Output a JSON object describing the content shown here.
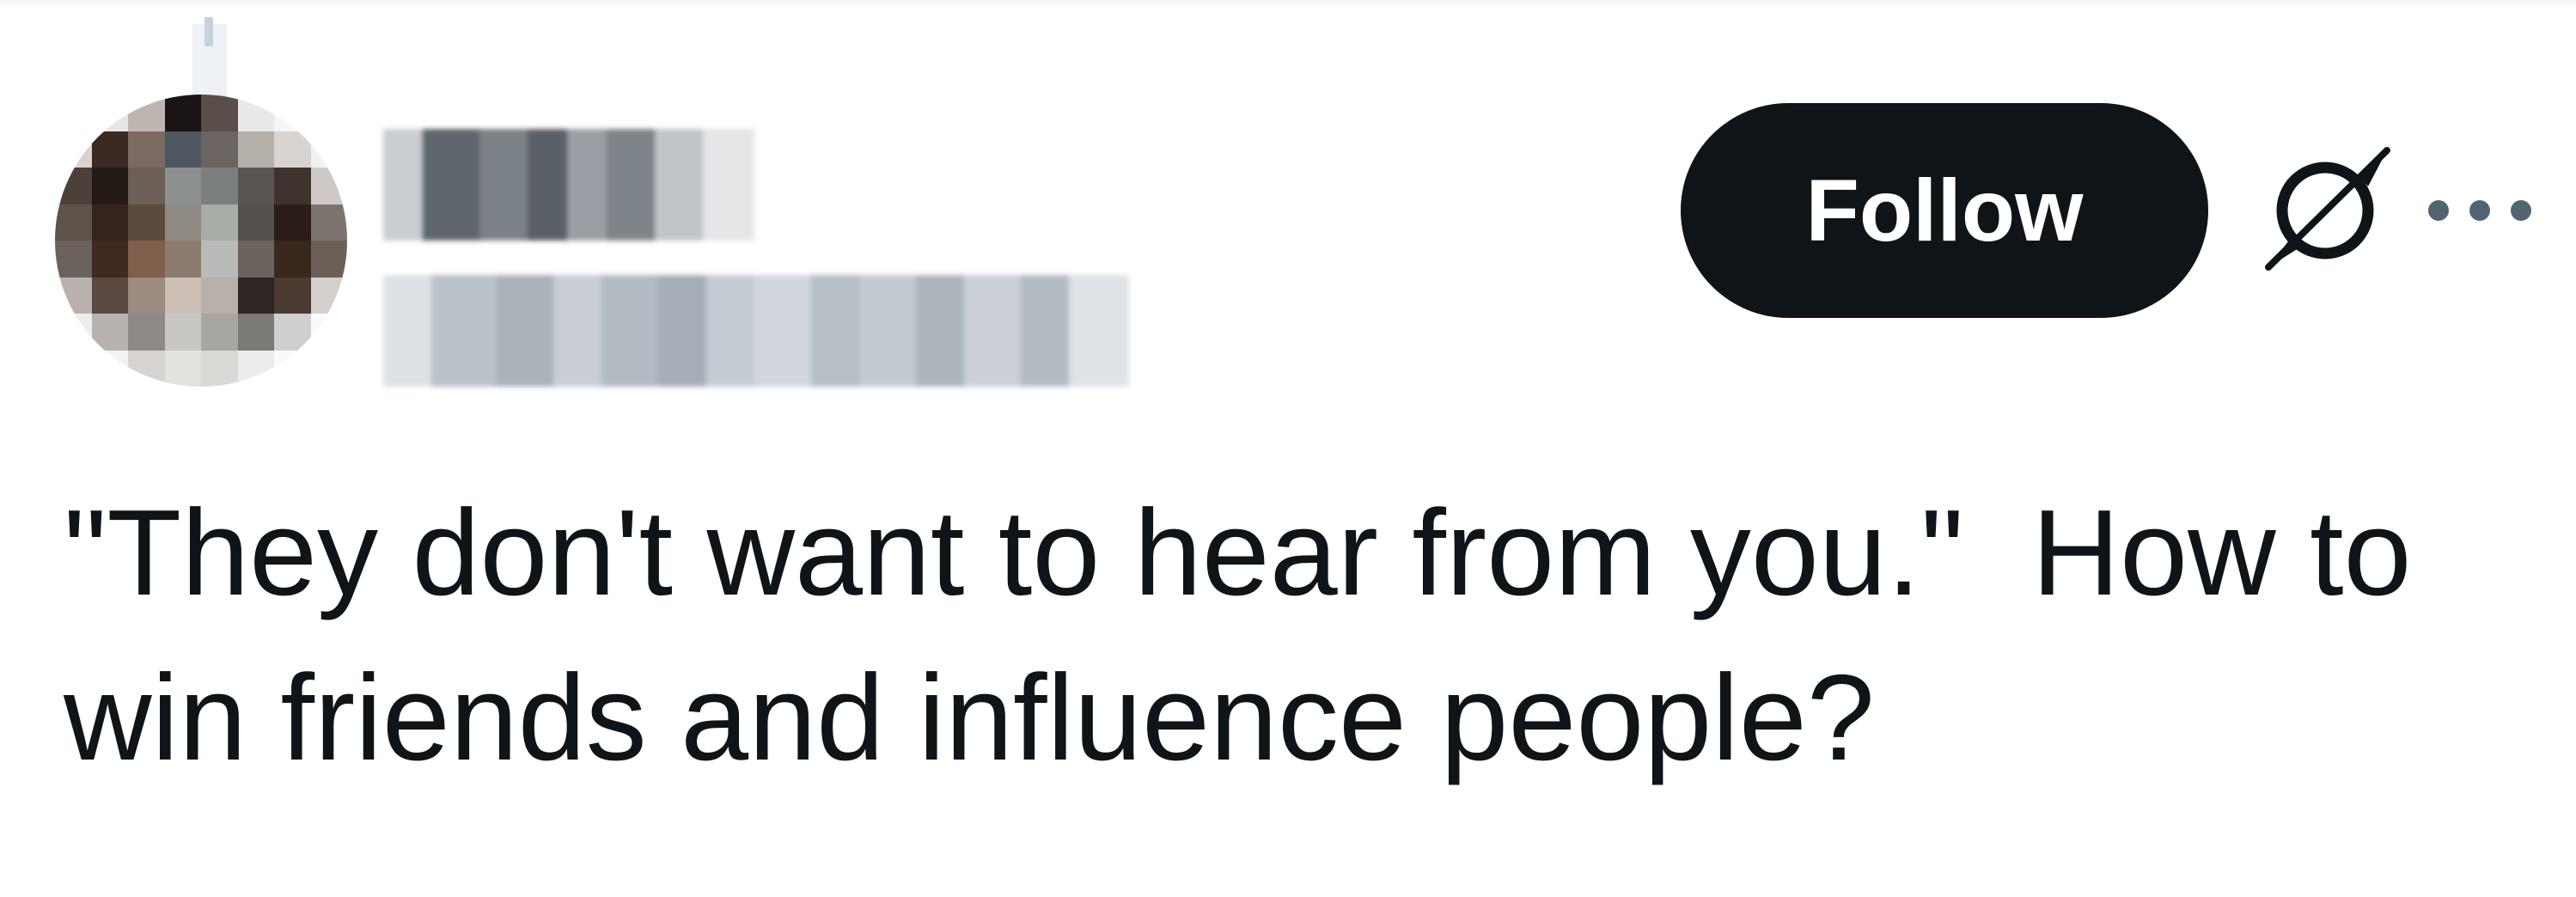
{
  "post": {
    "author": {
      "name": "",
      "handle": "",
      "avatar_icon": "avatar-image"
    },
    "follow_label": "Follow",
    "grok_icon": "grok-icon",
    "more_icon": "more-horizontal-icon",
    "text": "\"They don't want to hear from you.\"  How to win friends and influence people?"
  },
  "colors": {
    "text": "#0f1419",
    "button_bg": "#0f1419",
    "button_text": "#ffffff",
    "secondary": "#536471"
  }
}
